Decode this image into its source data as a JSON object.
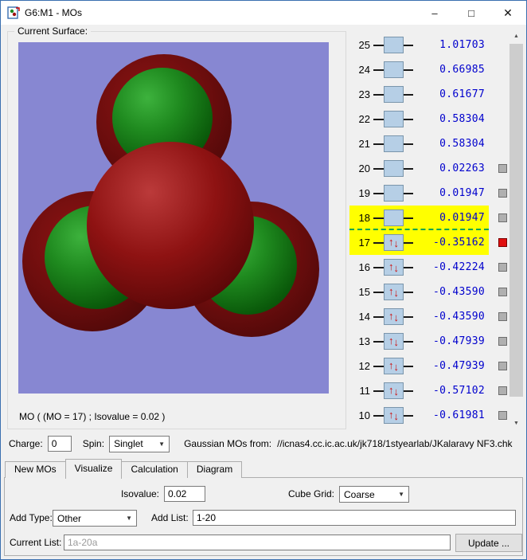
{
  "window": {
    "title": "G6:M1 - MOs",
    "controls": {
      "minimize": "–",
      "maximize": "□",
      "close": "✕"
    }
  },
  "surface": {
    "group_label": "Current Surface:",
    "caption": "MO ( (MO = 17) ; Isovalue = 0.02 )"
  },
  "mo_list": {
    "rows": [
      {
        "num": "25",
        "occupied": false,
        "energy": "1.01703",
        "checkbox": "none",
        "highlight": false
      },
      {
        "num": "24",
        "occupied": false,
        "energy": "0.66985",
        "checkbox": "none",
        "highlight": false
      },
      {
        "num": "23",
        "occupied": false,
        "energy": "0.61677",
        "checkbox": "none",
        "highlight": false
      },
      {
        "num": "22",
        "occupied": false,
        "energy": "0.58304",
        "checkbox": "none",
        "highlight": false
      },
      {
        "num": "21",
        "occupied": false,
        "energy": "0.58304",
        "checkbox": "none",
        "highlight": false
      },
      {
        "num": "20",
        "occupied": false,
        "energy": "0.02263",
        "checkbox": "gray",
        "highlight": false
      },
      {
        "num": "19",
        "occupied": false,
        "energy": "0.01947",
        "checkbox": "gray",
        "highlight": false
      },
      {
        "num": "18",
        "occupied": false,
        "energy": "0.01947",
        "checkbox": "gray",
        "highlight": true,
        "insert_line": true
      },
      {
        "num": "17",
        "occupied": true,
        "energy": "-0.35162",
        "checkbox": "red",
        "highlight": true
      },
      {
        "num": "16",
        "occupied": true,
        "energy": "-0.42224",
        "checkbox": "gray",
        "highlight": false
      },
      {
        "num": "15",
        "occupied": true,
        "energy": "-0.43590",
        "checkbox": "gray",
        "highlight": false
      },
      {
        "num": "14",
        "occupied": true,
        "energy": "-0.43590",
        "checkbox": "gray",
        "highlight": false
      },
      {
        "num": "13",
        "occupied": true,
        "energy": "-0.47939",
        "checkbox": "gray",
        "highlight": false
      },
      {
        "num": "12",
        "occupied": true,
        "energy": "-0.47939",
        "checkbox": "gray",
        "highlight": false
      },
      {
        "num": "11",
        "occupied": true,
        "energy": "-0.57102",
        "checkbox": "gray",
        "highlight": false
      },
      {
        "num": "10",
        "occupied": true,
        "energy": "-0.61981",
        "checkbox": "gray",
        "highlight": false
      }
    ]
  },
  "footer": {
    "charge_label": "Charge:",
    "charge_value": "0",
    "spin_label": "Spin:",
    "spin_value": "Singlet",
    "source_label": "Gaussian MOs from:",
    "source_path": "//icnas4.cc.ic.ac.uk/jk718/1styearlab/JKalaravy NF3.chk"
  },
  "tabs": [
    {
      "label": "New MOs",
      "active": false
    },
    {
      "label": "Visualize",
      "active": true
    },
    {
      "label": "Calculation",
      "active": false
    },
    {
      "label": "Diagram",
      "active": false
    }
  ],
  "visualize_tab": {
    "isovalue_label": "Isovalue:",
    "isovalue_value": "0.02",
    "cube_grid_label": "Cube Grid:",
    "cube_grid_value": "Coarse",
    "add_type_label": "Add Type:",
    "add_type_value": "Other",
    "add_list_label": "Add List:",
    "add_list_value": "1-20",
    "current_list_label": "Current List:",
    "current_list_value": "1a-20a",
    "update_button": "Update ..."
  },
  "colors": {
    "energy_text": "#0000cd",
    "row_highlight": "#ffff00",
    "viewer_background": "#8787d2",
    "sphere_green": "#1f8a1f",
    "sphere_red": "#8e1212",
    "checkbox_red": "#e01010",
    "checkbox_gray": "#b0b0b0",
    "orbital_box": "#b6cfe6"
  }
}
